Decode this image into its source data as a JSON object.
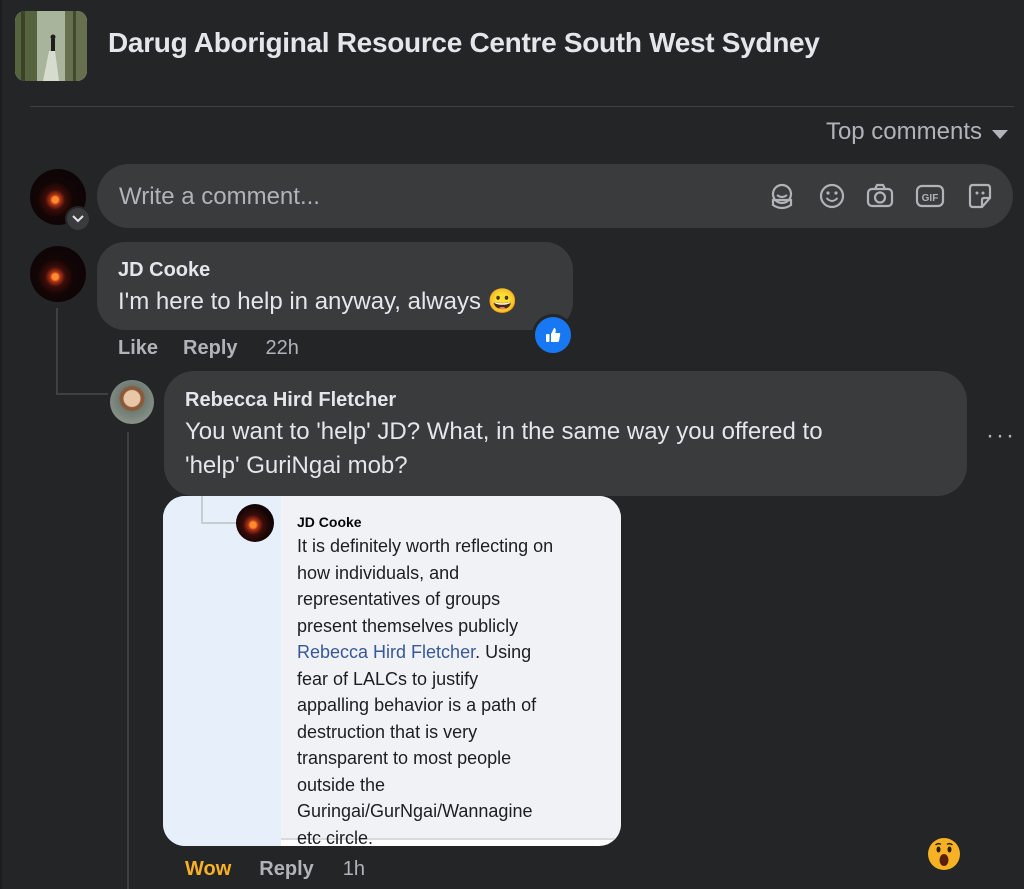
{
  "header": {
    "group_name": "Darug Aboriginal Resource Centre South West Sydney"
  },
  "sort": {
    "label": "Top comments"
  },
  "composer": {
    "placeholder": "Write a comment...",
    "icons": [
      "avatar-sticker-icon",
      "emoji-icon",
      "camera-icon",
      "gif-icon",
      "sticker-icon"
    ]
  },
  "comments": [
    {
      "author": "JD Cooke",
      "text": "I'm here to help in anyway, always",
      "emoji": "😀",
      "reaction": "like-icon",
      "actions": {
        "like": "Like",
        "reply": "Reply",
        "time": "22h"
      }
    },
    {
      "author": "Rebecca Hird Fletcher",
      "text_line1": "You want to 'help' JD? What, in the same way you offered to",
      "text_line2": "'help' GuriNgai mob?",
      "more": "···",
      "attachment": {
        "author": "JD Cooke",
        "lines": [
          "It is definitely worth reflecting on",
          "how individuals, and",
          "representatives of groups",
          "present themselves publicly",
          "Rebecca Hird Fletcher",
          ". Using",
          "fear of LALCs to justify",
          "appalling behavior is a path of",
          "destruction that is very",
          "transparent to most people",
          "outside the",
          "Guringai/GurNgai/Wannagine",
          "etc circle."
        ]
      },
      "reaction": "wow-icon",
      "actions": {
        "wow": "Wow",
        "reply": "Reply",
        "time": "1h"
      }
    }
  ],
  "colors": {
    "background": "#242526",
    "bubble": "#3a3b3c",
    "text_primary": "#e4e6eb",
    "text_secondary": "#b0b3b8",
    "like_blue": "#1877f2",
    "wow_yellow": "#f7b125",
    "mention_blue": "#385898"
  }
}
